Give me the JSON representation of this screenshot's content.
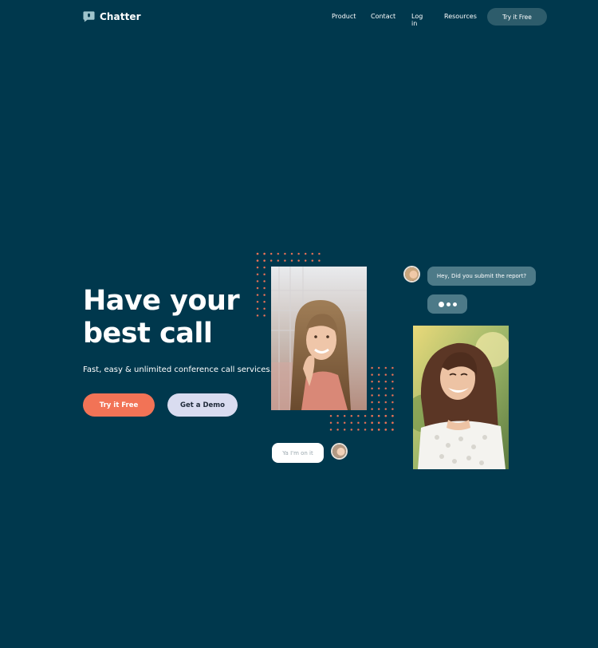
{
  "brand": {
    "name": "Chatter",
    "icon": "chat-bubble-icon"
  },
  "nav": {
    "links": [
      "Product",
      "Contact",
      "Log in",
      "Resources"
    ],
    "cta": "Try it Free"
  },
  "hero": {
    "title_line1": "Have your",
    "title_line2": "best call",
    "subtitle": "Fast, easy & unlimited conference call services.",
    "primary_button": "Try it Free",
    "secondary_button": "Get a Demo"
  },
  "chat": {
    "incoming_message": "Hey, Did you submit the report?",
    "outgoing_message": "Ya I'm on it"
  },
  "colors": {
    "background": "#00384d",
    "accent": "#f27356",
    "secondary_button": "#d9dcf0",
    "bubble": "#4d7a88",
    "nav_button": "#2d5c6b"
  }
}
